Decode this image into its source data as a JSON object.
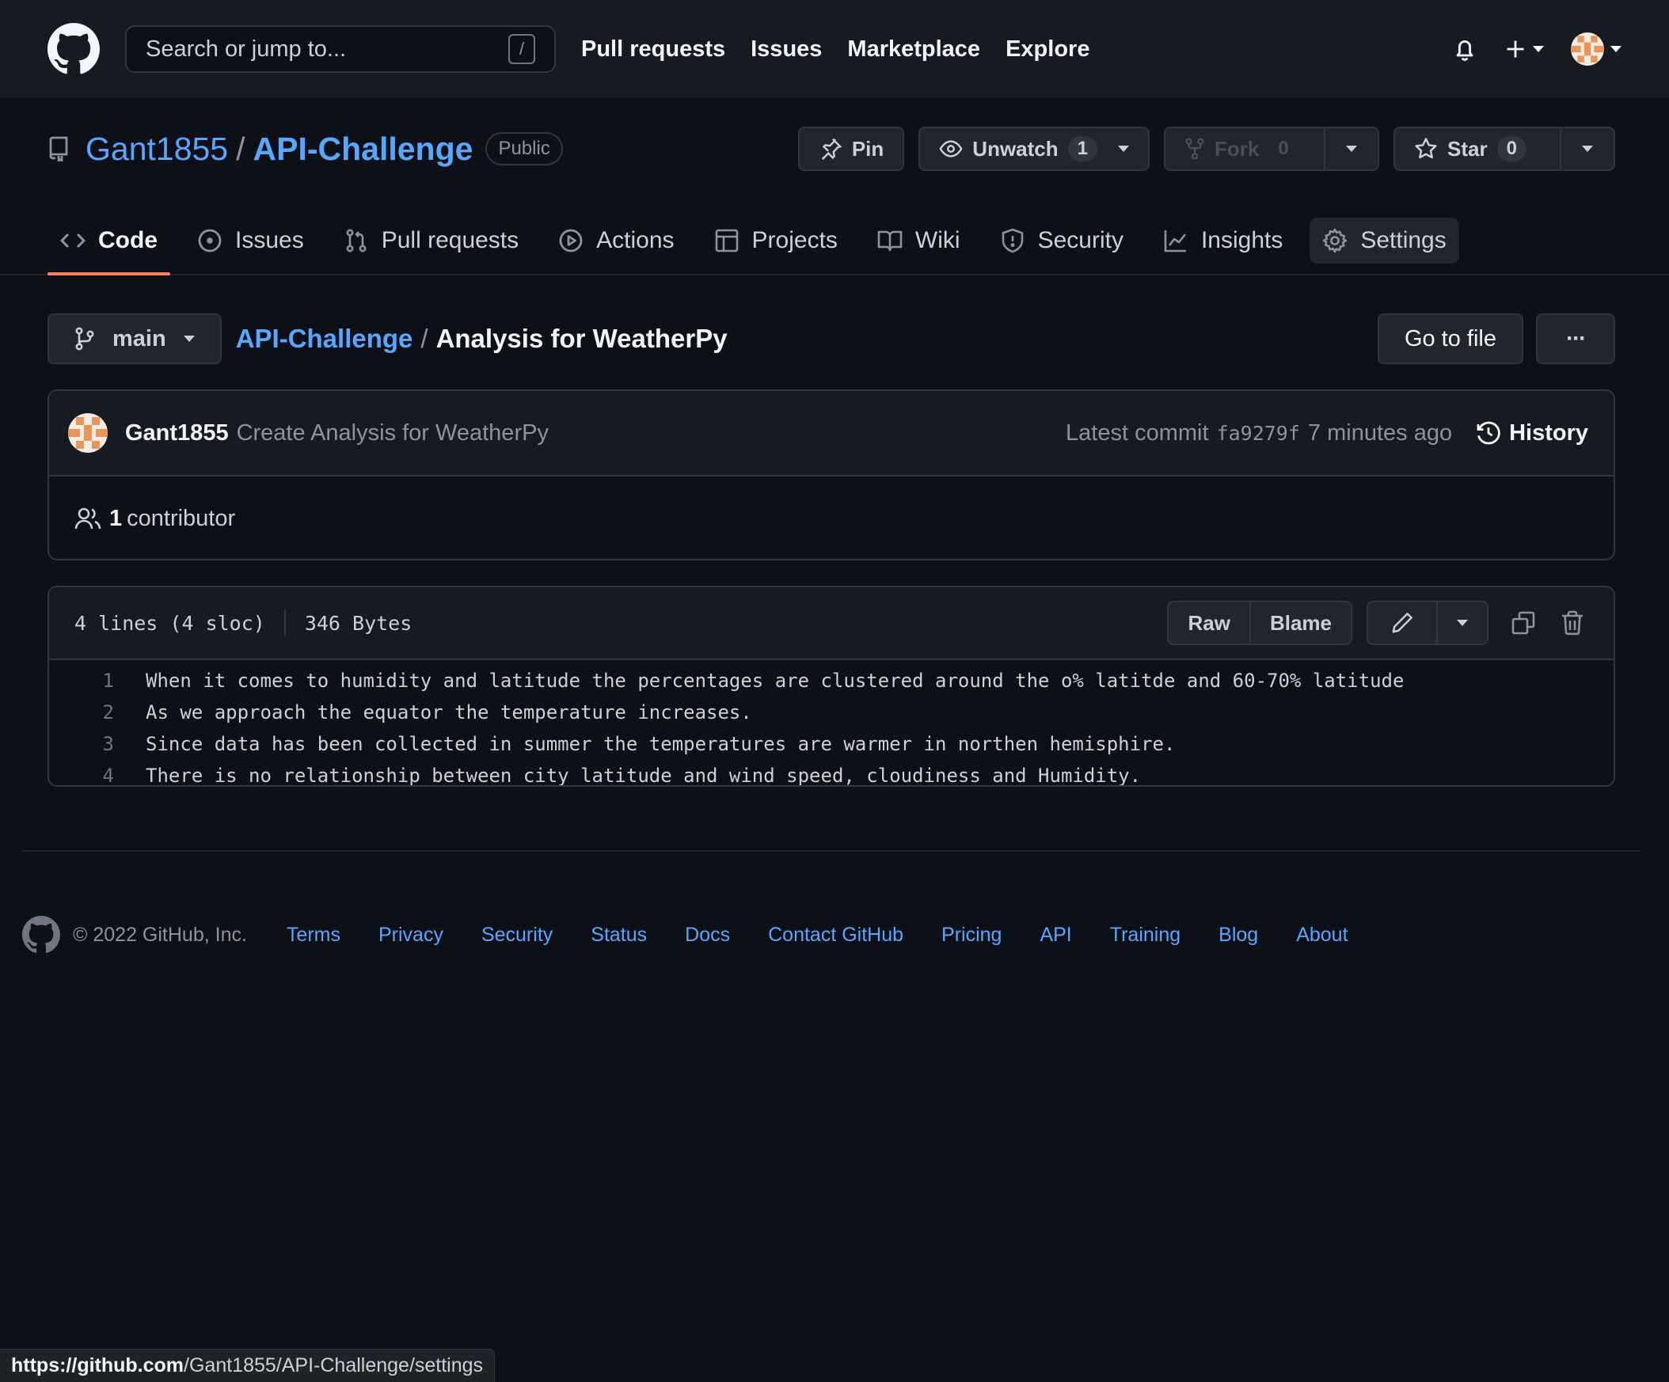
{
  "header": {
    "search_placeholder": "Search or jump to...",
    "search_shortcut": "/",
    "nav": [
      "Pull requests",
      "Issues",
      "Marketplace",
      "Explore"
    ]
  },
  "repo": {
    "owner": "Gant1855",
    "separator": "/",
    "name": "API-Challenge",
    "visibility": "Public",
    "pin_label": "Pin",
    "unwatch_label": "Unwatch",
    "watch_count": "1",
    "fork_label": "Fork",
    "fork_count": "0",
    "star_label": "Star",
    "star_count": "0"
  },
  "tabs": [
    {
      "label": "Code",
      "icon": "code-icon",
      "active": true
    },
    {
      "label": "Issues",
      "icon": "issue-icon"
    },
    {
      "label": "Pull requests",
      "icon": "pull-request-icon"
    },
    {
      "label": "Actions",
      "icon": "play-icon"
    },
    {
      "label": "Projects",
      "icon": "table-icon"
    },
    {
      "label": "Wiki",
      "icon": "book-icon"
    },
    {
      "label": "Security",
      "icon": "shield-icon"
    },
    {
      "label": "Insights",
      "icon": "graph-icon"
    },
    {
      "label": "Settings",
      "icon": "gear-icon",
      "hovered": true
    }
  ],
  "file_nav": {
    "branch": "main",
    "breadcrumb_repo": "API-Challenge",
    "breadcrumb_sep": "/",
    "file_name": "Analysis for WeatherPy",
    "goto_label": "Go to file",
    "more_label": "···"
  },
  "commit": {
    "author": "Gant1855",
    "message": "Create Analysis for WeatherPy",
    "latest_label": "Latest commit",
    "sha": "fa9279f",
    "time": "7 minutes ago",
    "history_label": "History",
    "contributor_count": "1",
    "contributor_label": "contributor"
  },
  "file": {
    "lines_info": "4 lines (4 sloc)",
    "size": "346 Bytes",
    "raw_label": "Raw",
    "blame_label": "Blame",
    "lines": [
      {
        "n": "1",
        "text": "When it comes to humidity and latitude the percentages are clustered around the o% latitde and 60-70% latitude"
      },
      {
        "n": "2",
        "text": "As we approach the equator the temperature increases."
      },
      {
        "n": "3",
        "text": "Since data has been collected in summer the temperatures are warmer in northen hemisphire."
      },
      {
        "n": "4",
        "text": "There is no relationship between city latitude and wind speed, cloudiness and Humidity."
      }
    ]
  },
  "footer": {
    "copyright": "© 2022 GitHub, Inc.",
    "links": [
      "Terms",
      "Privacy",
      "Security",
      "Status",
      "Docs",
      "Contact GitHub",
      "Pricing",
      "API",
      "Training",
      "Blog",
      "About"
    ]
  },
  "status_bar": {
    "host": "https://github.com",
    "path": "/Gant1855/API-Challenge/settings"
  },
  "colors": {
    "background": "#0d1117",
    "header_bg": "#161b22",
    "link": "#58a6ff",
    "active_tab_underline": "#f78166",
    "avatar_orange": "#e8955a"
  }
}
